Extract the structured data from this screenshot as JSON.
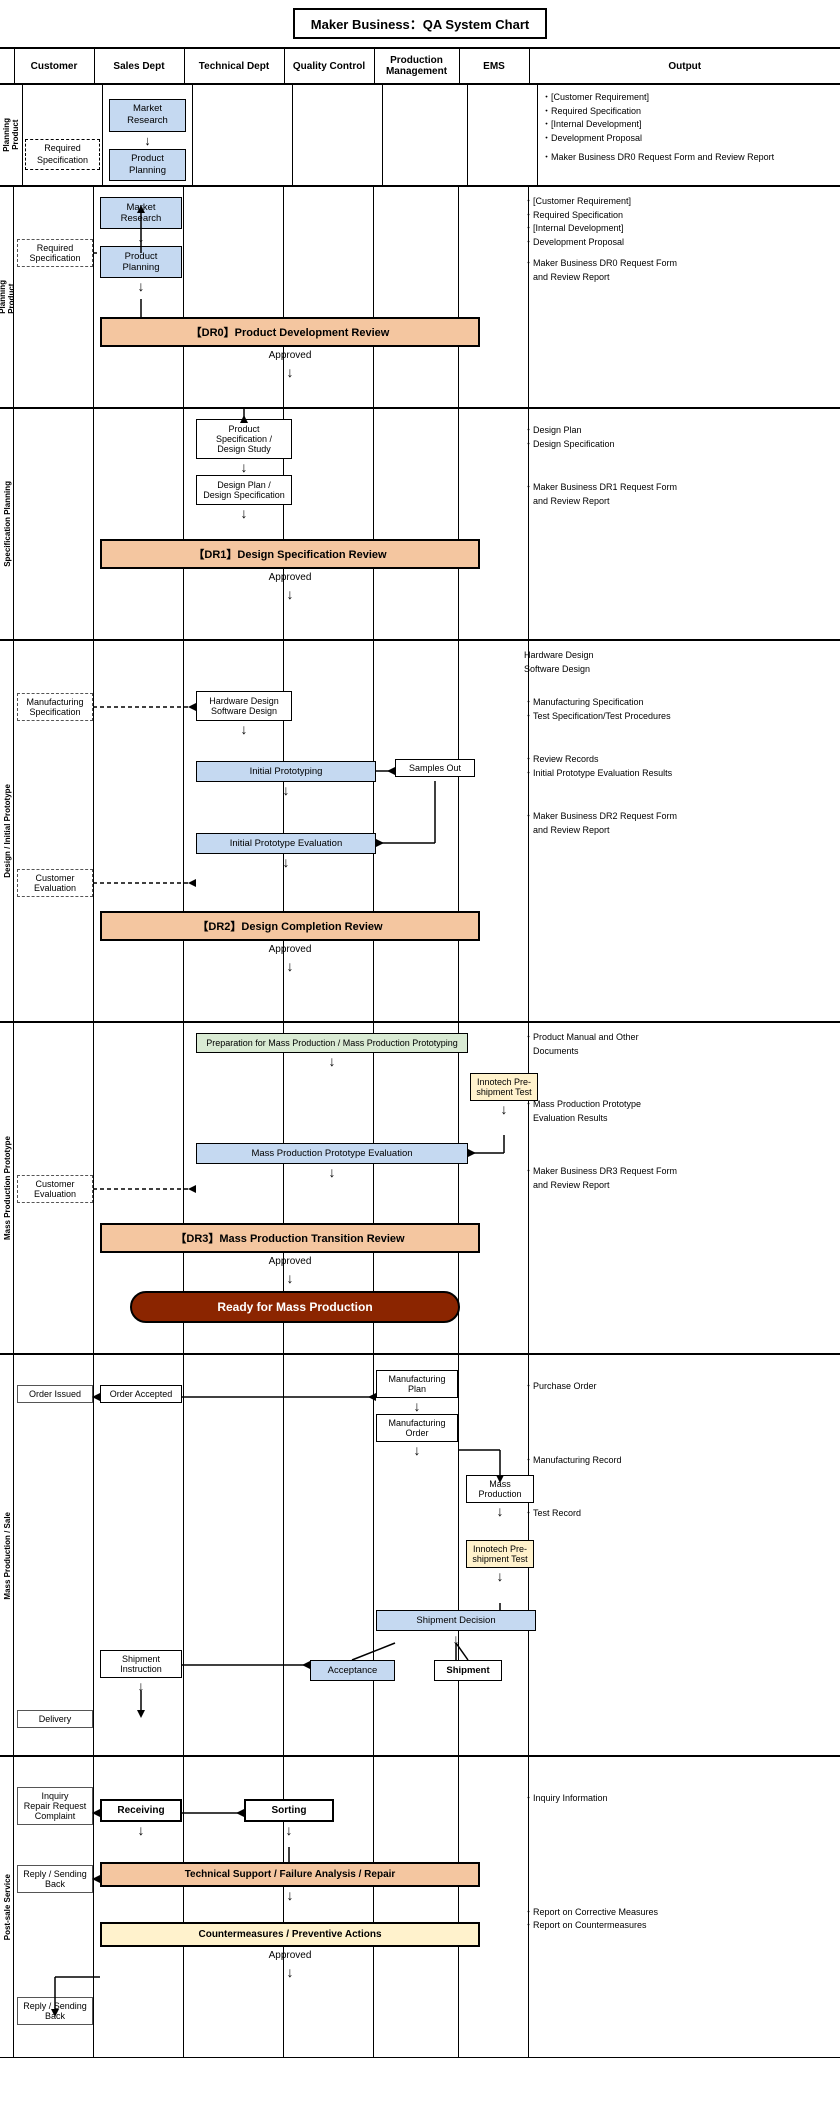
{
  "title": "Maker Business：QA System Chart",
  "columns": {
    "phase": "",
    "customer": "Customer",
    "sales_dept": "Sales Dept",
    "technical_dept": "Technical Dept",
    "quality_control": "Quality Control",
    "production_management": "Production Management",
    "ems": "EMS",
    "output": "Output"
  },
  "sections": {
    "product_planning": {
      "label": "P\nr\no\nd\nu\nc\nt\n\nP\nl\na\nn\nn\ni\nn\ng",
      "label_short": "Product Planning",
      "nodes": {
        "required_spec": "Required Specification",
        "market_research": "Market Research",
        "product_planning": "Product Planning",
        "dr0_review": "【DR0】Product Development Review",
        "approved": "Approved"
      },
      "output": {
        "lines": [
          "・[Customer Requirement]",
          "・Required Specification",
          "・[Internal Development]",
          "・Development Proposal",
          "",
          "・Maker Business DR0 Request Form",
          "　and Review Report"
        ]
      }
    },
    "spec_planning": {
      "label": "S\np\ne\nc\ni\nf\ni\nc\na\nt\ni\no\nn\n\nP\nl\na\nn\nn\ni\nn\ng",
      "label_short": "Specification Planning",
      "nodes": {
        "product_spec": "Product Specification / Design Study",
        "design_plan": "Design Plan / Design Specification",
        "dr1_review": "【DR1】Design Specification Review",
        "approved": "Approved"
      },
      "output": {
        "lines": [
          "・Design Plan",
          "・Design Specification",
          "",
          "・Maker Business DR1 Request Form",
          "　and Review Report"
        ]
      }
    },
    "design_initial": {
      "label": "D\ne\ns\ni\ng\nn\n\n/\n\nI\nn\ni\nt\ni\na\nl\n\nP\nr\no\nt\no\nt\ny\np\ne",
      "label_short": "Design / Initial Prototype",
      "nodes": {
        "mfg_spec": "Manufacturing Specification",
        "hw_sw_design": "Hardware Design\nSoftware Design",
        "initial_proto": "Initial Prototyping",
        "samples_out": "Samples Out",
        "initial_eval": "Initial Prototype Evaluation",
        "customer_eval": "Customer Evaluation",
        "dr2_review": "【DR2】Design Completion Review",
        "approved": "Approved"
      },
      "output": {
        "lines": [
          "Hardware Design",
          "Software Design",
          "",
          "・Manufacturing Specification",
          "・Test Specification/Test Procedures",
          "",
          "・Review Records",
          "・Initial Prototype Evaluation Results",
          "",
          "・Maker Business DR2 Request Form",
          "　and Review Report"
        ]
      }
    },
    "mass_prod_proto": {
      "label": "M\na\ns\ns\n\nP\nr\no\nd\nu\nc\nt\ni\no\nn\n\nP\nr\no\nt\no\nt\ny\np\ne",
      "label_short": "Mass Production Prototype",
      "nodes": {
        "prep_mass_prod": "Preparation for Mass Production / Mass Production Prototyping",
        "innotech_pre": "Innotech Pre-shipment Test",
        "mass_prod_eval": "Mass Production Prototype Evaluation",
        "customer_eval": "Customer Evaluation",
        "dr3_review": "【DR3】Mass Production Transition Review",
        "approved": "Approved",
        "ready": "Ready for Mass Production"
      },
      "output": {
        "lines": [
          "・Product Manual and Other",
          "　Documents",
          "",
          "・Mass Production Prototype",
          "　Evaluation Results",
          "",
          "・Maker Business DR3 Request Form",
          "　and Review Report"
        ]
      }
    },
    "mass_production_sale": {
      "label": "M\na\ns\ns\n\nP\nr\no\nd\nu\nc\nt\ni\no\nn\n\n/\n\nS\na\nl\ne",
      "label_short": "Mass Production / Sale",
      "nodes": {
        "order_issued": "Order Issued",
        "order_accepted": "Order Accepted",
        "mfg_plan": "Manufacturing Plan",
        "mfg_order": "Manufacturing Order",
        "mass_production": "Mass Production",
        "innotech_pre": "Innotech Pre-shipment Test",
        "shipment_decision": "Shipment Decision",
        "acceptance": "Acceptance",
        "shipment": "Shipment",
        "shipment_instruction": "Shipment Instruction",
        "delivery": "Delivery"
      },
      "output": {
        "lines": [
          "・Purchase Order",
          "",
          "・Manufacturing Record",
          "",
          "・Test Record"
        ]
      }
    },
    "post_sale_service": {
      "label": "P\no\ns\nt\n-\ns\na\nl\ne\n\nS\ne\nr\nv\ni\nc\ne",
      "label_short": "Post-sale Service",
      "nodes": {
        "inquiry": "Inquiry\nRepair Request\nComplaint",
        "receiving": "Receiving",
        "sorting": "Sorting",
        "reply_sending_back1": "Reply / Sending Back",
        "tech_support": "Technical Support / Failure Analysis / Repair",
        "countermeasures": "Countermeasures / Preventive Actions",
        "approved": "Approved",
        "reply_sending_back2": "Reply / Sending Back"
      },
      "output": {
        "lines": [
          "・Inquiry Information",
          "",
          "・Report on Corrective Measures",
          "・Report on Countermeasures"
        ]
      }
    }
  }
}
